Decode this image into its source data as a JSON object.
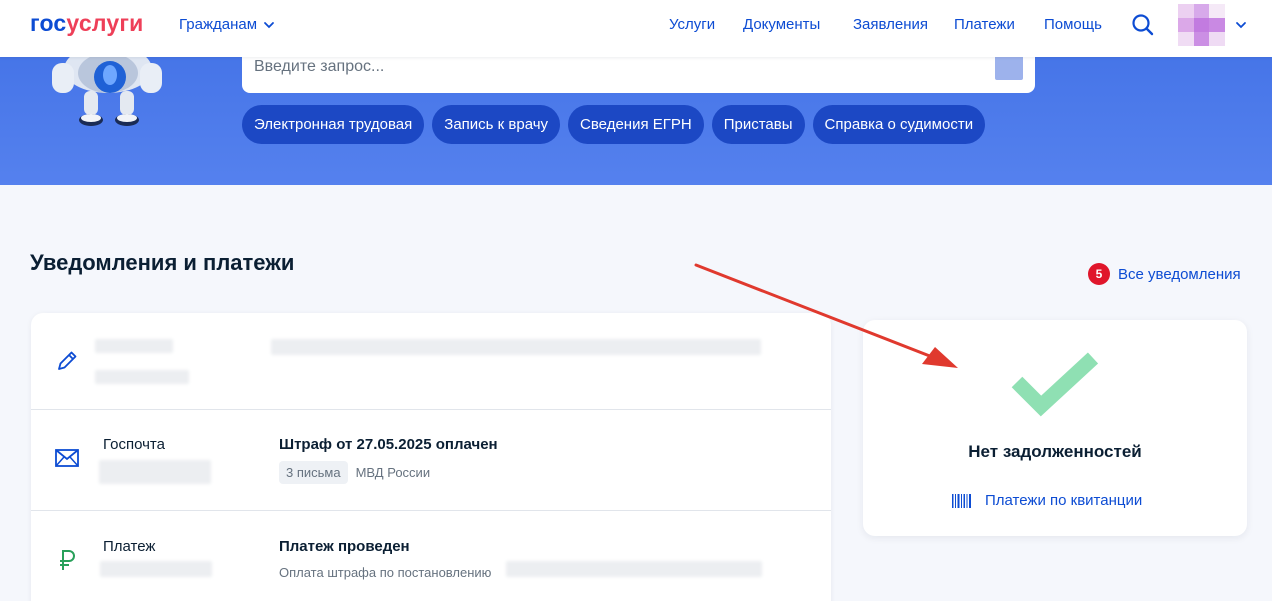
{
  "header": {
    "logo_part1": "гос",
    "logo_part2": "услуги",
    "audience_label": "Гражданам",
    "nav": [
      "Услуги",
      "Документы",
      "Заявления",
      "Платежи",
      "Помощь"
    ]
  },
  "search": {
    "placeholder": "Введите запрос..."
  },
  "quick_links": [
    "Электронная трудовая",
    "Запись к врачу",
    "Сведения ЕГРН",
    "Приставы",
    "Справка о судимости"
  ],
  "section": {
    "title": "Уведомления и платежи",
    "all_notifications_label": "Все уведомления",
    "unread_count": "5"
  },
  "notifications": [
    {
      "source": "",
      "title": "",
      "icon": "pencil-icon"
    },
    {
      "source": "Госпочта",
      "title": "Штраф от 27.05.2025 оплачен",
      "tag": "3 письма",
      "sender": "МВД России",
      "icon": "envelope-icon"
    },
    {
      "source": "Платеж",
      "title": "Платеж проведен",
      "description": "Оплата штрафа по постановлению",
      "icon": "ruble-icon"
    }
  ],
  "debt": {
    "status": "Нет задолженностей",
    "receipt_link": "Платежи по квитанции"
  },
  "colors": {
    "brand_blue": "#0d4cd3",
    "brand_red": "#ee3f58",
    "hero": "#4675e8",
    "chip": "#1c48c4",
    "success": "#8fe0b3",
    "annotation_arrow": "#e0392e",
    "badge": "#e0162b"
  }
}
